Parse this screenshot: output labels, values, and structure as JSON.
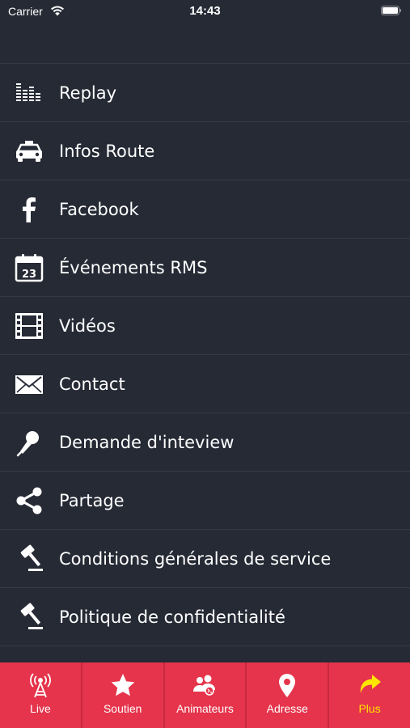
{
  "status_bar": {
    "carrier": "Carrier",
    "time": "14:43"
  },
  "menu": {
    "items": [
      {
        "label": "Replay",
        "icon": "equalizer-icon"
      },
      {
        "label": "Infos Route",
        "icon": "taxi-icon"
      },
      {
        "label": "Facebook",
        "icon": "facebook-icon"
      },
      {
        "label": "Événements RMS",
        "icon": "calendar-icon",
        "calendar_day": "23"
      },
      {
        "label": "Vidéos",
        "icon": "film-icon"
      },
      {
        "label": "Contact",
        "icon": "envelope-icon"
      },
      {
        "label": "Demande d'inteview",
        "icon": "microphone-icon"
      },
      {
        "label": "Partage",
        "icon": "share-icon"
      },
      {
        "label": "Conditions générales de service",
        "icon": "gavel-icon"
      },
      {
        "label": "Politique de confidentialité",
        "icon": "gavel-icon"
      }
    ]
  },
  "tabbar": {
    "tabs": [
      {
        "label": "Live",
        "icon": "antenna-icon"
      },
      {
        "label": "Soutien",
        "icon": "star-icon"
      },
      {
        "label": "Animateurs",
        "icon": "users-icon"
      },
      {
        "label": "Adresse",
        "icon": "map-pin-icon"
      },
      {
        "label": "Plus",
        "icon": "forward-arrow-icon",
        "active": true
      }
    ]
  },
  "colors": {
    "background": "#262a35",
    "divider": "#353a46",
    "tabbar": "#e5344b",
    "active_tab": "#ffe600",
    "text": "#ffffff"
  }
}
